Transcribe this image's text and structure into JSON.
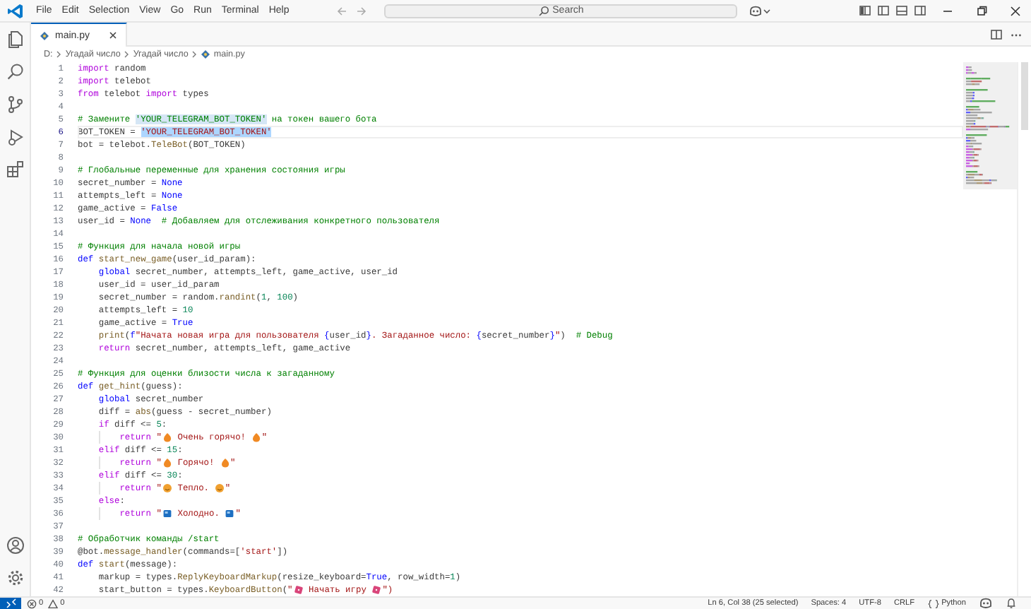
{
  "menu": [
    "File",
    "Edit",
    "Selection",
    "View",
    "Go",
    "Run",
    "Terminal",
    "Help"
  ],
  "command_center": {
    "label": "Search"
  },
  "activity": [
    {
      "kind": "explorer"
    },
    {
      "kind": "search"
    },
    {
      "kind": "source-control"
    },
    {
      "kind": "run"
    },
    {
      "kind": "extensions"
    }
  ],
  "activity_bottom": [
    {
      "kind": "account"
    },
    {
      "kind": "settings"
    }
  ],
  "tabs": [
    {
      "label": "main.py",
      "selected": true
    }
  ],
  "breadcrumbs": [
    "D:",
    "Угадай число",
    "Угадай число",
    "main.py"
  ],
  "editor": {
    "lines": [
      {
        "number": "1",
        "tokens": [
          {
            "text": "import",
            "kind": "ctl"
          },
          {
            "text": " random",
            "kind": "plain"
          }
        ]
      },
      {
        "number": "2",
        "tokens": [
          {
            "text": "import",
            "kind": "ctl"
          },
          {
            "text": " telebot",
            "kind": "plain"
          }
        ]
      },
      {
        "number": "3",
        "tokens": [
          {
            "text": "from",
            "kind": "ctl"
          },
          {
            "text": " telebot ",
            "kind": "plain"
          },
          {
            "text": "import",
            "kind": "ctl"
          },
          {
            "text": " types",
            "kind": "plain"
          }
        ]
      },
      {
        "number": "4"
      },
      {
        "number": "5",
        "tokens": [
          {
            "text": "# Замените ",
            "kind": "com"
          },
          {
            "text": "'YOUR_TELEGRAM_BOT_TOKEN'",
            "kind": "com",
            "match": true
          },
          {
            "text": " на токен вашего бота",
            "kind": "com"
          }
        ]
      },
      {
        "number": "6",
        "tokens": [
          {
            "text": "BOT_TOKEN = ",
            "kind": "plain"
          },
          {
            "text": "'YOUR_TELEGRAM_BOT_TOKEN'",
            "kind": "str",
            "selected": true
          }
        ]
      },
      {
        "number": "7",
        "tokens": [
          {
            "text": "bot = telebot.",
            "kind": "plain"
          },
          {
            "text": "TeleBot",
            "kind": "fn"
          },
          {
            "text": "(BOT_TOKEN)",
            "kind": "plain"
          }
        ]
      },
      {
        "number": "8"
      },
      {
        "number": "9",
        "tokens": [
          {
            "text": "# Глобальные переменные для хранения состояния игры",
            "kind": "com"
          }
        ]
      },
      {
        "number": "10",
        "tokens": [
          {
            "text": "secret_number = ",
            "kind": "plain"
          },
          {
            "text": "None",
            "kind": "con"
          }
        ]
      },
      {
        "number": "11",
        "tokens": [
          {
            "text": "attempts_left = ",
            "kind": "plain"
          },
          {
            "text": "None",
            "kind": "con"
          }
        ]
      },
      {
        "number": "12",
        "tokens": [
          {
            "text": "game_active = ",
            "kind": "plain"
          },
          {
            "text": "False",
            "kind": "con"
          }
        ]
      },
      {
        "number": "13",
        "tokens": [
          {
            "text": "user_id = ",
            "kind": "plain"
          },
          {
            "text": "None",
            "kind": "con"
          },
          {
            "text": "  # Добавляем для отслеживания конкретного пользователя",
            "kind": "com"
          }
        ]
      },
      {
        "number": "14"
      },
      {
        "number": "15",
        "tokens": [
          {
            "text": "# Функция для начала новой игры",
            "kind": "com"
          }
        ]
      },
      {
        "number": "16",
        "tokens": [
          {
            "text": "def ",
            "kind": "con"
          },
          {
            "text": "start_new_game",
            "kind": "fn"
          },
          {
            "text": "(user_id_param):",
            "kind": "plain"
          }
        ]
      },
      {
        "number": "17",
        "tokens": [
          {
            "text": "    global",
            "kind": "con"
          },
          {
            "text": " secret_number, attempts_left, game_active, user_id",
            "kind": "plain"
          }
        ]
      },
      {
        "number": "18",
        "tokens": [
          {
            "text": "    user_id = user_id_param",
            "kind": "plain"
          }
        ]
      },
      {
        "number": "19",
        "tokens": [
          {
            "text": "    secret_number = random.",
            "kind": "plain"
          },
          {
            "text": "randint",
            "kind": "fn"
          },
          {
            "text": "(",
            "kind": "plain"
          },
          {
            "text": "1",
            "kind": "num"
          },
          {
            "text": ", ",
            "kind": "plain"
          },
          {
            "text": "100",
            "kind": "num"
          },
          {
            "text": ")",
            "kind": "plain"
          }
        ]
      },
      {
        "number": "20",
        "tokens": [
          {
            "text": "    attempts_left = ",
            "kind": "plain"
          },
          {
            "text": "10",
            "kind": "num"
          }
        ]
      },
      {
        "number": "21",
        "tokens": [
          {
            "text": "    game_active = ",
            "kind": "plain"
          },
          {
            "text": "True",
            "kind": "con"
          }
        ]
      },
      {
        "number": "22",
        "tokens": [
          {
            "text": "    print",
            "kind": "fn"
          },
          {
            "text": "(",
            "kind": "plain"
          },
          {
            "text": "f",
            "kind": "con"
          },
          {
            "text": "\"Начата новая игра для пользователя ",
            "kind": "str"
          },
          {
            "text": "{",
            "kind": "con"
          },
          {
            "text": "user_id",
            "kind": "plain"
          },
          {
            "text": "}",
            "kind": "con"
          },
          {
            "text": ". Загаданное число: ",
            "kind": "str"
          },
          {
            "text": "{",
            "kind": "con"
          },
          {
            "text": "secret_number",
            "kind": "plain"
          },
          {
            "text": "}",
            "kind": "con"
          },
          {
            "text": "\"",
            "kind": "str"
          },
          {
            "text": ")",
            "kind": "plain"
          },
          {
            "text": "  # Debug",
            "kind": "com"
          }
        ]
      },
      {
        "number": "23",
        "tokens": [
          {
            "text": "    return",
            "kind": "ctl"
          },
          {
            "text": " secret_number, attempts_left, game_active",
            "kind": "plain"
          }
        ]
      },
      {
        "number": "24"
      },
      {
        "number": "25",
        "tokens": [
          {
            "text": "# Функция для оценки близости числа к загаданному",
            "kind": "com"
          }
        ]
      },
      {
        "number": "26",
        "tokens": [
          {
            "text": "def ",
            "kind": "con"
          },
          {
            "text": "get_hint",
            "kind": "fn"
          },
          {
            "text": "(guess):",
            "kind": "plain"
          }
        ]
      },
      {
        "number": "27",
        "tokens": [
          {
            "text": "    global",
            "kind": "con"
          },
          {
            "text": " secret_number",
            "kind": "plain"
          }
        ]
      },
      {
        "number": "28",
        "tokens": [
          {
            "text": "    diff = ",
            "kind": "plain"
          },
          {
            "text": "abs",
            "kind": "fn"
          },
          {
            "text": "(guess - secret_number)",
            "kind": "plain"
          }
        ]
      },
      {
        "number": "29",
        "tokens": [
          {
            "text": "    if",
            "kind": "ctl"
          },
          {
            "text": " diff <= ",
            "kind": "plain"
          },
          {
            "text": "5",
            "kind": "num"
          },
          {
            "text": ":",
            "kind": "plain"
          }
        ]
      },
      {
        "number": "30",
        "tokens": [
          {
            "text": "        return ",
            "kind": "ctl"
          },
          {
            "text": "\"",
            "kind": "str"
          },
          {
            "kind": "flame"
          },
          {
            "text": " Очень горячо! ",
            "kind": "str"
          },
          {
            "kind": "flame"
          },
          {
            "text": "\"",
            "kind": "str"
          }
        ]
      },
      {
        "number": "31",
        "tokens": [
          {
            "text": "    elif",
            "kind": "ctl"
          },
          {
            "text": " diff <= ",
            "kind": "plain"
          },
          {
            "text": "15",
            "kind": "num"
          },
          {
            "text": ":",
            "kind": "plain"
          }
        ]
      },
      {
        "number": "32",
        "tokens": [
          {
            "text": "        return ",
            "kind": "ctl"
          },
          {
            "text": "\"",
            "kind": "str"
          },
          {
            "kind": "flame"
          },
          {
            "text": " Горячо! ",
            "kind": "str"
          },
          {
            "kind": "flame"
          },
          {
            "text": "\"",
            "kind": "str"
          }
        ]
      },
      {
        "number": "33",
        "tokens": [
          {
            "text": "    elif",
            "kind": "ctl"
          },
          {
            "text": " diff <= ",
            "kind": "plain"
          },
          {
            "text": "30",
            "kind": "num"
          },
          {
            "text": ":",
            "kind": "plain"
          }
        ]
      },
      {
        "number": "34",
        "tokens": [
          {
            "text": "        return ",
            "kind": "ctl"
          },
          {
            "text": "\"",
            "kind": "str"
          },
          {
            "kind": "smile"
          },
          {
            "text": " Тепло. ",
            "kind": "str"
          },
          {
            "kind": "smile"
          },
          {
            "text": "\"",
            "kind": "str"
          }
        ]
      },
      {
        "number": "35",
        "tokens": [
          {
            "text": "    else",
            "kind": "ctl"
          },
          {
            "text": ":",
            "kind": "plain"
          }
        ]
      },
      {
        "number": "36",
        "tokens": [
          {
            "text": "        return ",
            "kind": "ctl"
          },
          {
            "text": "\"",
            "kind": "str"
          },
          {
            "kind": "ice"
          },
          {
            "text": " Холодно. ",
            "kind": "str"
          },
          {
            "kind": "ice"
          },
          {
            "text": "\"",
            "kind": "str"
          }
        ]
      },
      {
        "number": "37"
      },
      {
        "number": "38",
        "tokens": [
          {
            "text": "# Обработчик команды /start",
            "kind": "com"
          }
        ]
      },
      {
        "number": "39",
        "tokens": [
          {
            "text": "@bot.",
            "kind": "plain"
          },
          {
            "text": "message_handler",
            "kind": "fn"
          },
          {
            "text": "(commands=[",
            "kind": "plain"
          },
          {
            "text": "'start'",
            "kind": "str"
          },
          {
            "text": "])",
            "kind": "plain"
          }
        ]
      },
      {
        "number": "40",
        "tokens": [
          {
            "text": "def ",
            "kind": "con"
          },
          {
            "text": "start",
            "kind": "fn"
          },
          {
            "text": "(message):",
            "kind": "plain"
          }
        ]
      },
      {
        "number": "41",
        "tokens": [
          {
            "text": "    markup = types.",
            "kind": "plain"
          },
          {
            "text": "ReplyKeyboardMarkup",
            "kind": "fn"
          },
          {
            "text": "(resize_keyboard=",
            "kind": "plain"
          },
          {
            "text": "True",
            "kind": "con"
          },
          {
            "text": ", row_width=",
            "kind": "plain"
          },
          {
            "text": "1",
            "kind": "num"
          },
          {
            "text": ")",
            "kind": "plain"
          }
        ]
      },
      {
        "number": "42",
        "tokens": [
          {
            "text": "    start_button = types.",
            "kind": "plain"
          },
          {
            "text": "KeyboardButton",
            "kind": "fn"
          },
          {
            "text": "(",
            "kind": "plain"
          },
          {
            "text": "\"",
            "kind": "str"
          },
          {
            "kind": "dice"
          },
          {
            "text": " Начать игру ",
            "kind": "str"
          },
          {
            "kind": "dice"
          },
          {
            "text": "\")",
            "kind": "str"
          }
        ]
      }
    ]
  },
  "status_bar": {
    "errors": "0",
    "warnings": "0",
    "items": [
      "Ln 6, Col 38 (25 selected)",
      "Spaces: 4",
      "UTF-8",
      "CRLF"
    ],
    "language": "Python"
  }
}
